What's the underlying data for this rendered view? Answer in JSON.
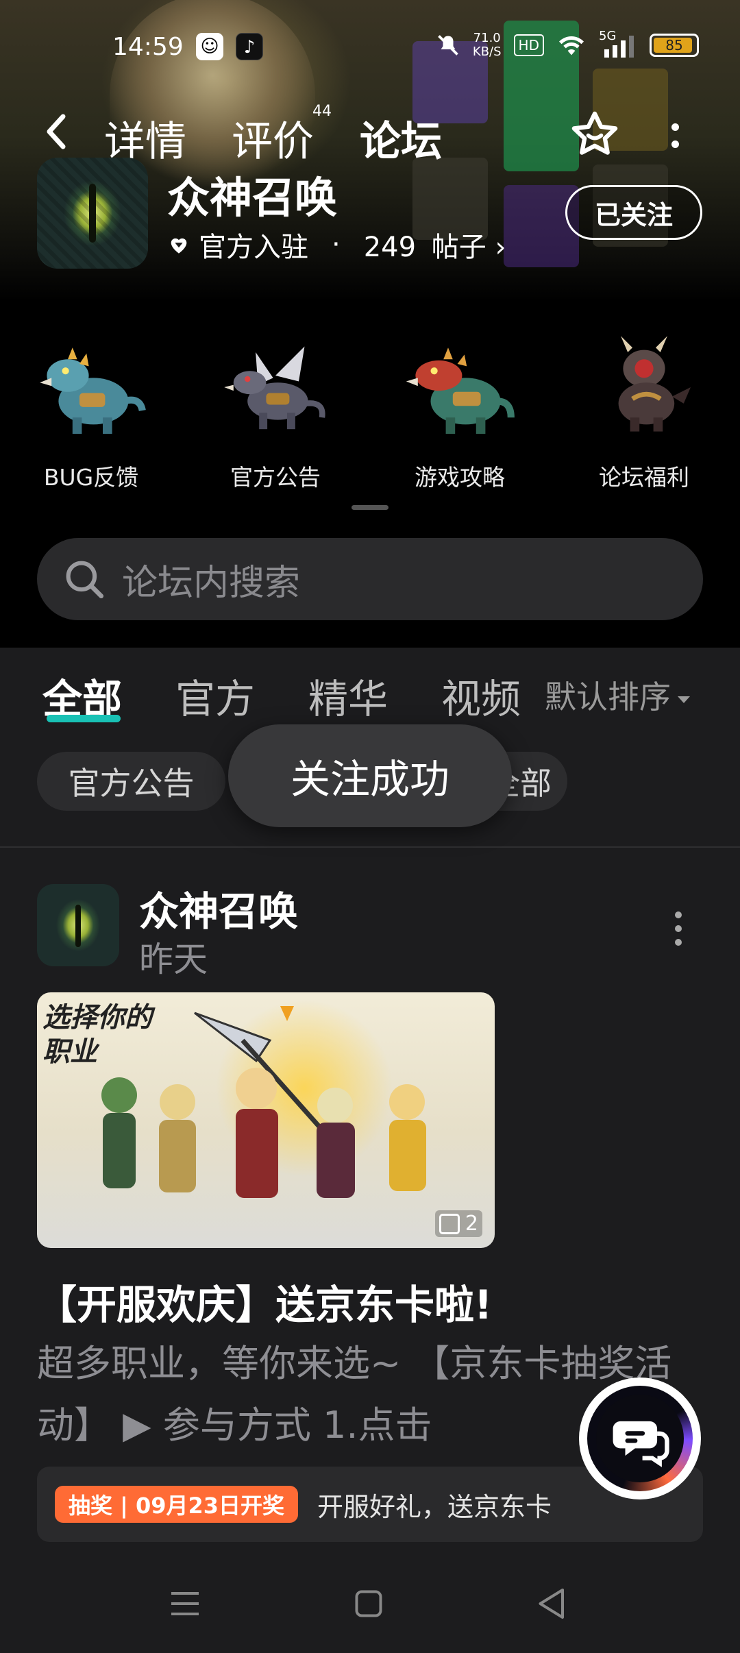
{
  "status_bar": {
    "time": "14:59",
    "net_speed_value": "71.0",
    "net_speed_unit": "KB/S",
    "hd_badge": "HD",
    "signal_label": "5G",
    "battery": "85",
    "icons": [
      "qq-icon",
      "tiktok-icon",
      "mute-icon",
      "wifi-icon",
      "signal-icon",
      "battery-icon"
    ]
  },
  "top_nav": {
    "tabs": [
      {
        "label": "详情"
      },
      {
        "label": "评价",
        "badge": "44"
      },
      {
        "label": "论坛",
        "active": true
      }
    ]
  },
  "game": {
    "title": "众神召唤",
    "official_label": "官方入驻",
    "separator": "·",
    "post_count": "249",
    "post_unit": "帖子",
    "follow_label": "已关注"
  },
  "categories": [
    {
      "label": "BUG反馈"
    },
    {
      "label": "官方公告"
    },
    {
      "label": "游戏攻略"
    },
    {
      "label": "论坛福利"
    }
  ],
  "search": {
    "placeholder": "论坛内搜索"
  },
  "filter_tabs": [
    {
      "label": "全部",
      "active": true
    },
    {
      "label": "官方"
    },
    {
      "label": "精华"
    },
    {
      "label": "视频"
    }
  ],
  "sort_label": "默认排序",
  "chips": [
    {
      "label": "官方公告"
    },
    {
      "label": "全部"
    }
  ],
  "toast": "关注成功",
  "post": {
    "author": "众神召唤",
    "time": "昨天",
    "image_text_line1": "选择你的",
    "image_text_line2": "职业",
    "image_count": "2",
    "title": "【开服欢庆】送京东卡啦!",
    "excerpt": "超多职业，等你来选~ 【京东卡抽奖活动】 ▶ 参与方式 1.点击",
    "lottery_tag": "抽奖 | 09月23日开奖",
    "lottery_text": "开服好礼，送京东卡"
  },
  "colors": {
    "accent": "#19c1b5",
    "lottery_tag": "#ff6b35",
    "background": "#1c1c1e"
  }
}
